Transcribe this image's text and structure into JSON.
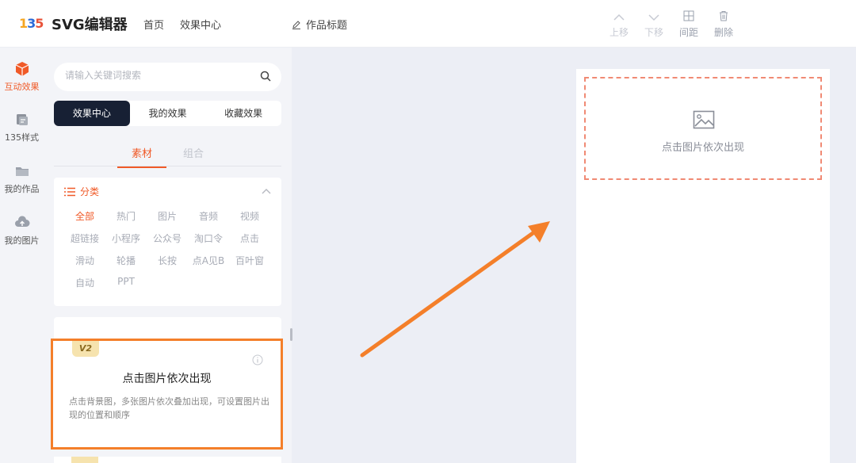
{
  "app": {
    "logo_text": [
      "1",
      "3",
      "5"
    ],
    "brand": "SVG编辑器",
    "nav": [
      "首页",
      "效果中心"
    ],
    "work_title": "作品标题"
  },
  "toolbar": {
    "up": "上移",
    "down": "下移",
    "spacing": "间距",
    "delete": "删除"
  },
  "rail": [
    {
      "label": "互动效果",
      "icon": "cube-icon",
      "active": true
    },
    {
      "label": "135样式",
      "icon": "style-icon",
      "active": false
    },
    {
      "label": "我的作品",
      "icon": "folder-icon",
      "active": false
    },
    {
      "label": "我的图片",
      "icon": "cloud-upload-icon",
      "active": false
    }
  ],
  "search": {
    "placeholder": "请输入关键词搜索",
    "value": ""
  },
  "segments": [
    "效果中心",
    "我的效果",
    "收藏效果"
  ],
  "subtabs": [
    "素材",
    "组合"
  ],
  "categories": {
    "title": "分类",
    "items": [
      "全部",
      "热门",
      "图片",
      "音频",
      "视频",
      "超链接",
      "小程序",
      "公众号",
      "淘口令",
      "点击",
      "滑动",
      "轮播",
      "长按",
      "点A见B",
      "百叶窗",
      "自动",
      "PPT"
    ]
  },
  "effect_card": {
    "badge": "V2",
    "title": "点击图片依次出现",
    "description": "点击背景图，多张图片依次叠加出现，可设置图片出现的位置和顺序"
  },
  "canvas": {
    "placeholder_text": "点击图片依次出现"
  },
  "colors": {
    "accent": "#f05a28",
    "dark": "#172034",
    "highlight": "#f47f2a",
    "arrow": "#f47f2a"
  }
}
